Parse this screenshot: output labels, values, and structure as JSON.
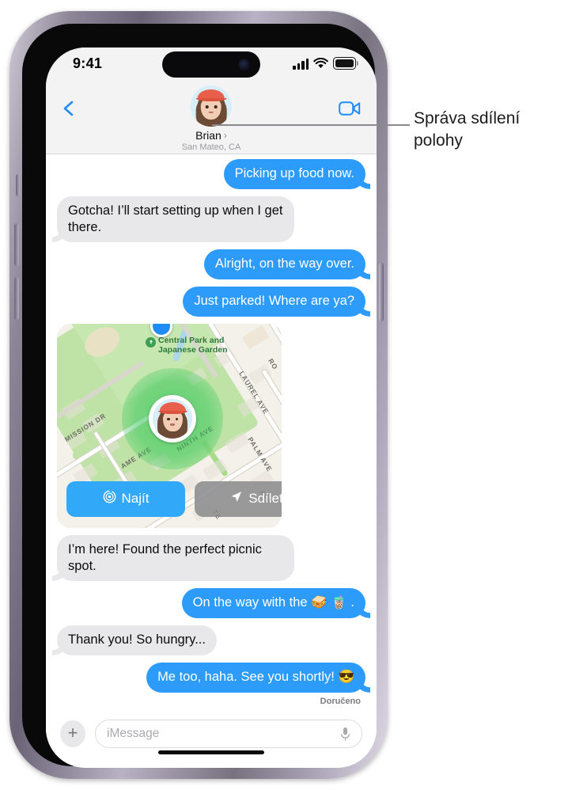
{
  "status_bar": {
    "time": "9:41",
    "cellular_icon": "cellular-signal-icon",
    "wifi_icon": "wifi-icon",
    "battery_icon": "battery-icon"
  },
  "header": {
    "back_icon": "back-chevron-icon",
    "facetime_icon": "video-camera-icon",
    "avatar_icon": "memoji-avatar",
    "contact_name": "Brian",
    "name_chevron": "›",
    "contact_subtitle": "San Mateo, CA"
  },
  "messages": [
    {
      "id": "m1",
      "side": "out",
      "text": "Picking up food now."
    },
    {
      "id": "m2",
      "side": "in",
      "text": "Gotcha! I’ll start setting up when I get there."
    },
    {
      "id": "m3",
      "side": "out",
      "text": "Alright, on the way over."
    },
    {
      "id": "m4",
      "side": "out",
      "text": "Just parked! Where are ya?"
    },
    {
      "id": "m5",
      "side": "in",
      "text": "I’m here! Found the perfect picnic spot."
    },
    {
      "id": "m6",
      "side": "out",
      "text": "On the way with the 🥪 🧋 ."
    },
    {
      "id": "m7",
      "side": "in",
      "text": "Thank you! So hungry..."
    },
    {
      "id": "m8",
      "side": "out",
      "text": "Me too, haha. See you shortly! 😎"
    }
  ],
  "delivered_label": "Doručeno",
  "map_card": {
    "poi_label": "Central Park and Japanese Garden",
    "poi_icon": "park-tree-pin-icon",
    "self_location_icon": "current-location-dot",
    "friend_pin_icon": "friend-memoji-pin",
    "street_labels": [
      "MISSION DR",
      "NINTH AVE",
      "LAUREL AVE",
      "PALM AVE",
      "AME AVE",
      "RO",
      "AVE",
      "TE"
    ],
    "find_button": {
      "label": "Najít",
      "icon": "radar-target-icon",
      "color": "#32a9f8"
    },
    "share_button": {
      "label": "Sdílet",
      "icon": "navigation-arrow-icon",
      "color": "#8a8a8c"
    }
  },
  "input_bar": {
    "plus_icon": "plus-icon",
    "plus_label": "+",
    "placeholder": "iMessage",
    "mic_icon": "microphone-icon"
  },
  "callout": {
    "text": "Správa sdílení polohy"
  },
  "colors": {
    "outgoing_bubble": "#2d9bf9",
    "incoming_bubble": "#e8e8ea",
    "accent_blue": "#1d8cf8",
    "header_bg": "#f3f3f4",
    "location_green": "#34c759"
  }
}
